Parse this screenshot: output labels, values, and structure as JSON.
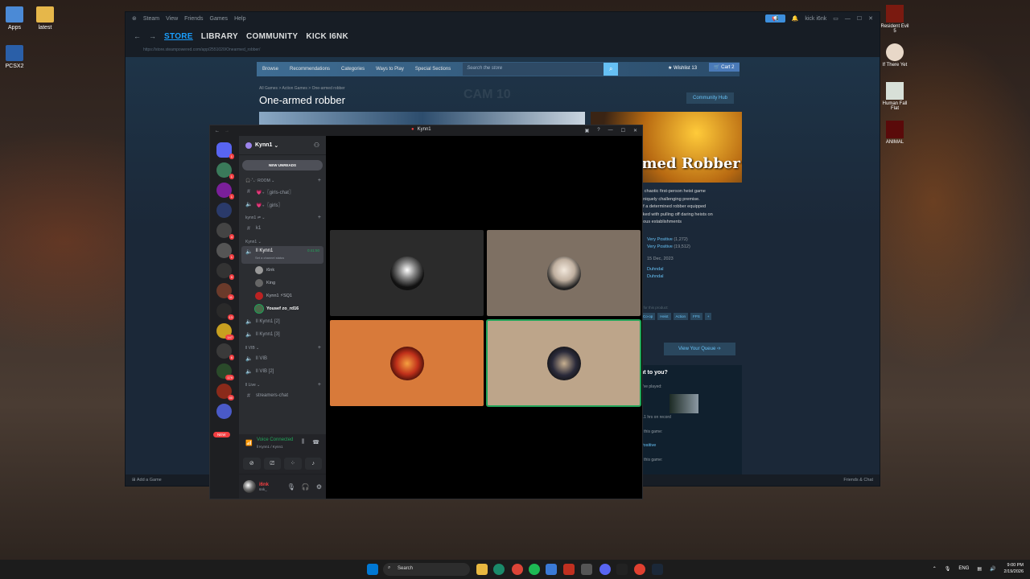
{
  "desktop": {
    "left_icons": [
      {
        "label": "Apps"
      },
      {
        "label": "latest"
      },
      {
        "label": "PCSX2"
      }
    ],
    "right_icons": [
      {
        "label": "Resident Evil 5"
      },
      {
        "label": "If There Yet"
      },
      {
        "label": "Human Fall Flat"
      },
      {
        "label": "ANIMAL"
      }
    ]
  },
  "steam": {
    "titlebar": {
      "menu": [
        "Steam",
        "View",
        "Friends",
        "Games",
        "Help"
      ],
      "user": "kick i6nk"
    },
    "nav": [
      "STORE",
      "LIBRARY",
      "COMMUNITY",
      "KICK I6NK"
    ],
    "url": "https://store.steampowered.com/app/2551020/Onearmed_robber/",
    "store_menu": [
      "Browse",
      "Recommendations",
      "Categories",
      "Ways to Play",
      "Special Sections"
    ],
    "search_placeholder": "Search the store",
    "wishlist": "Wishlist",
    "wishlist_count": "13",
    "cart": "Cart",
    "cart_count": "2",
    "breadcrumb": "All Games > Action Games > One-armed robber",
    "game_title": "One-armed robber",
    "community_hub": "Community Hub",
    "capsule_title": "rmed Robber",
    "description_lines": [
      "a chaotic first-person heist game",
      "uniquely challenging premise.",
      "of a determined robber equipped",
      "sked with pulling off daring heists on",
      "rious establishments"
    ],
    "reviews": [
      {
        "label": "Very Positive",
        "count": "(1,272)"
      },
      {
        "label": "Very Positive",
        "count": "(19,512)"
      }
    ],
    "release_date": "15 Dec, 2023",
    "developers": [
      "Duhndal",
      "Duhndal"
    ],
    "tags_label": "s for this product:",
    "tags": [
      "Co-op",
      "Heist",
      "Action",
      "FPS",
      "+"
    ],
    "view_queue": "View Your Queue",
    "relevant": {
      "title": "nt to you?",
      "played": "u've played:",
      "hours": "1.1 hrs on record",
      "this_game": "e this game:",
      "positive": "Positive",
      "this_game2": "d this game:"
    },
    "cam_overlay": "CAM 10",
    "footer_left": "Add a Game",
    "footer_right": "Friends & Chat"
  },
  "discord": {
    "title": "Kynn1",
    "server_name": "Kynn1",
    "new_unreads": "NEW UNREADS",
    "categories": [
      {
        "name": "🎧·˚₊‧ ROOM",
        "channels": [
          {
            "name": "💗₊〖girls-chat〗",
            "type": "text"
          },
          {
            "name": "💗₊〖girls〗",
            "type": "voice"
          }
        ]
      },
      {
        "name": "kynn1 ⇌",
        "channels": [
          {
            "name": "k1",
            "type": "text"
          }
        ]
      },
      {
        "name": "Kynn1",
        "channels": []
      }
    ],
    "active_channel": {
      "name": "ll Kynn1",
      "timer": "0:41:50",
      "status": "Set a channel status"
    },
    "voice_users": [
      {
        "name": "i6nk",
        "bold": false
      },
      {
        "name": "King",
        "bold": false
      },
      {
        "name": "Kynn1 ⚡SQ1",
        "bold": false
      },
      {
        "name": "Yousef zo_rd16",
        "bold": true
      }
    ],
    "more_channels": [
      {
        "name": "ll Kynn1 [2]",
        "type": "voice"
      },
      {
        "name": "ll Kynn1 [3]",
        "type": "voice"
      }
    ],
    "vib_category": "ll VIB",
    "vib_channels": [
      "ll VIB",
      "ll VIB [2]"
    ],
    "live_category": "ll Live",
    "live_channels": [
      "streamers-chat"
    ],
    "voice_status": "Voice Connected",
    "voice_sub": "ll Kynn1 / Kynn1",
    "user": {
      "name": "i6nk",
      "status": "6nk_"
    },
    "guild_badges": [
      "1",
      "1",
      "1",
      "",
      "4",
      "1",
      "9",
      "11",
      "13",
      "147",
      "6",
      "179",
      "40",
      "",
      "",
      "NEW"
    ],
    "new_label": "NEW"
  },
  "taskbar": {
    "search": "Search",
    "lang": "ENG",
    "time": "9:00 PM",
    "date": "2/19/2026"
  }
}
